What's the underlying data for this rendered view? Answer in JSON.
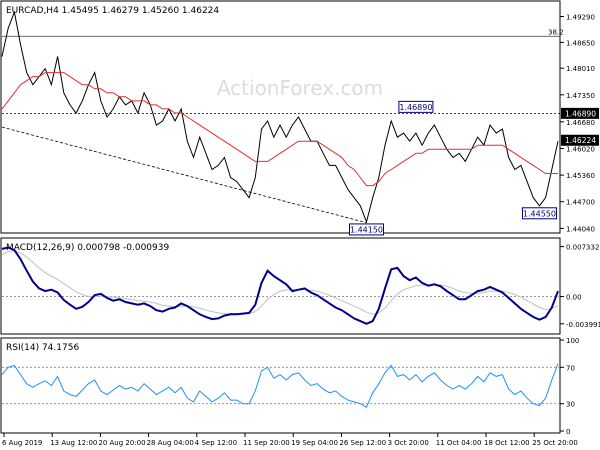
{
  "chart_data": [
    {
      "type": "candlestick",
      "header": "EURCAD,H4  1.45495 1.46279 1.45260 1.46224",
      "watermark": "ActionForex.com",
      "x_labels": [
        "6 Aug 2019",
        "13 Aug 12:00",
        "20 Aug 20:00",
        "28 Aug 04:00",
        "4 Sep 12:00",
        "11 Sep 20:00",
        "19 Sep 04:00",
        "26 Sep 12:00",
        "3 Oct 20:00",
        "11 Oct 04:00",
        "18 Oct 12:00",
        "25 Oct 20:00"
      ],
      "y_ticks": [
        1.4404,
        1.447,
        1.4536,
        1.4602,
        1.4668,
        1.4735,
        1.4801,
        1.4865,
        1.4929
      ],
      "y_tick_labels": [
        "1.44040",
        "1.44700",
        "1.45360",
        "1.46020",
        "1.46680",
        "1.47350",
        "1.48010",
        "1.48650",
        "1.49290"
      ],
      "ylim": [
        1.4395,
        1.4965
      ],
      "grid": false,
      "price_close": [
        1.483,
        1.49,
        1.494,
        1.486,
        1.479,
        1.476,
        1.478,
        1.48,
        1.476,
        1.483,
        1.474,
        1.471,
        1.469,
        1.472,
        1.476,
        1.479,
        1.472,
        1.468,
        1.47,
        1.473,
        1.471,
        1.472,
        1.469,
        1.474,
        1.471,
        1.466,
        1.467,
        1.47,
        1.467,
        1.47,
        1.462,
        1.458,
        1.463,
        1.459,
        1.455,
        1.456,
        1.458,
        1.453,
        1.452,
        1.45,
        1.448,
        1.453,
        1.465,
        1.467,
        1.463,
        1.466,
        1.463,
        1.466,
        1.468,
        1.465,
        1.462,
        1.462,
        1.459,
        1.456,
        1.456,
        1.453,
        1.45,
        1.448,
        1.446,
        1.442,
        1.448,
        1.453,
        1.461,
        1.467,
        1.463,
        1.464,
        1.462,
        1.464,
        1.461,
        1.464,
        1.466,
        1.463,
        1.46,
        1.458,
        1.459,
        1.457,
        1.46,
        1.463,
        1.461,
        1.466,
        1.464,
        1.465,
        1.458,
        1.455,
        1.456,
        1.452,
        1.448,
        1.446,
        1.448,
        1.455,
        1.462
      ],
      "moving_average_values": [
        1.47,
        1.472,
        1.474,
        1.476,
        1.477,
        1.478,
        1.478,
        1.479,
        1.479,
        1.479,
        1.479,
        1.478,
        1.477,
        1.476,
        1.476,
        1.475,
        1.475,
        1.474,
        1.474,
        1.473,
        1.473,
        1.472,
        1.472,
        1.472,
        1.471,
        1.471,
        1.47,
        1.47,
        1.469,
        1.469,
        1.468,
        1.467,
        1.466,
        1.465,
        1.464,
        1.463,
        1.462,
        1.461,
        1.46,
        1.459,
        1.458,
        1.457,
        1.457,
        1.457,
        1.458,
        1.459,
        1.46,
        1.461,
        1.462,
        1.462,
        1.462,
        1.462,
        1.461,
        1.46,
        1.459,
        1.458,
        1.456,
        1.455,
        1.453,
        1.451,
        1.451,
        1.452,
        1.454,
        1.455,
        1.456,
        1.457,
        1.458,
        1.459,
        1.459,
        1.46,
        1.46,
        1.46,
        1.46,
        1.46,
        1.46,
        1.46,
        1.46,
        1.461,
        1.461,
        1.461,
        1.461,
        1.461,
        1.46,
        1.459,
        1.458,
        1.457,
        1.456,
        1.455,
        1.454,
        1.454,
        1.454
      ],
      "trendline": {
        "start": 1.4655,
        "end": 1.4418
      },
      "resistance_level": 1.4689,
      "fib_level": 1.488,
      "fib_label": "38.2",
      "annotations": [
        {
          "label": "1.46890",
          "value": 1.4689,
          "index": 67
        },
        {
          "label": "1.44150",
          "value": 1.4415,
          "index": 59
        },
        {
          "label": "1.44550",
          "value": 1.4455,
          "index": 87
        }
      ],
      "last_price_label": "1.46224",
      "last_price": 1.46224
    },
    {
      "type": "line",
      "title": "MACD(12,26,9) 0.000798 -0.000939",
      "y_tick_labels": [
        "0.007332",
        "0.00",
        "-0.003991"
      ],
      "y_ticks": [
        0.007332,
        0.0,
        -0.003991
      ],
      "ylim": [
        -0.0052,
        0.0083
      ],
      "zero_line": 0.0,
      "series": [
        {
          "values": [
            0.007,
            0.0072,
            0.0068,
            0.0055,
            0.0038,
            0.0022,
            0.0012,
            0.0008,
            0.001,
            0.0006,
            -0.0005,
            -0.0012,
            -0.0018,
            -0.0015,
            -0.0008,
            0.0002,
            0.0004,
            -0.0002,
            -0.0006,
            -0.0004,
            -0.0008,
            -0.001,
            -0.0012,
            -0.001,
            -0.0014,
            -0.002,
            -0.0022,
            -0.0018,
            -0.0016,
            -0.001,
            -0.0014,
            -0.002,
            -0.0026,
            -0.003,
            -0.0033,
            -0.0032,
            -0.0028,
            -0.0026,
            -0.0026,
            -0.0025,
            -0.0024,
            -0.0012,
            0.002,
            0.0038,
            0.003,
            0.0024,
            0.0018,
            0.0008,
            0.001,
            0.0012,
            0.0006,
            0.0002,
            -0.0004,
            -0.001,
            -0.0016,
            -0.002,
            -0.0026,
            -0.0032,
            -0.0036,
            -0.004,
            -0.0036,
            -0.0018,
            0.0012,
            0.004,
            0.0042,
            0.003,
            0.0024,
            0.0028,
            0.002,
            0.0016,
            0.0018,
            0.0015,
            0.0008,
            0.0002,
            -0.0004,
            -0.0004,
            0.0002,
            0.0008,
            0.001,
            0.0014,
            0.001,
            0.0006,
            -0.0002,
            -0.001,
            -0.0018,
            -0.0024,
            -0.003,
            -0.0034,
            -0.003,
            -0.0016,
            0.0008
          ]
        },
        {
          "values": [
            0.0062,
            0.0066,
            0.0067,
            0.0064,
            0.0058,
            0.005,
            0.0042,
            0.0035,
            0.003,
            0.0025,
            0.0019,
            0.0013,
            0.0007,
            0.0003,
            0.0,
            0.0,
            0.0001,
            0.0,
            -0.0001,
            -0.0002,
            -0.0003,
            -0.0004,
            -0.0006,
            -0.0007,
            -0.0008,
            -0.001,
            -0.0013,
            -0.0014,
            -0.0015,
            -0.0014,
            -0.0014,
            -0.0015,
            -0.0017,
            -0.002,
            -0.0022,
            -0.0024,
            -0.0025,
            -0.0025,
            -0.0025,
            -0.0025,
            -0.0025,
            -0.0022,
            -0.0014,
            -0.0004,
            0.0003,
            0.0008,
            0.001,
            0.001,
            0.001,
            0.001,
            0.0009,
            0.0008,
            0.0005,
            0.0002,
            -0.0002,
            -0.0006,
            -0.001,
            -0.0014,
            -0.0018,
            -0.0023,
            -0.0026,
            -0.0024,
            -0.0017,
            -0.0006,
            0.0004,
            0.001,
            0.0013,
            0.0016,
            0.0017,
            0.0017,
            0.0017,
            0.0017,
            0.0015,
            0.0012,
            0.0008,
            0.0006,
            0.0005,
            0.0005,
            0.0006,
            0.0008,
            0.0008,
            0.0008,
            0.0006,
            0.0003,
            -0.0001,
            -0.0006,
            -0.0011,
            -0.0016,
            -0.0019,
            -0.0018,
            -0.0013
          ]
        }
      ]
    },
    {
      "type": "line",
      "title": "RSI(14) 74.1756",
      "y_ticks": [
        100,
        70,
        30,
        0
      ],
      "y_tick_labels": [
        "100",
        "70",
        "30",
        "0"
      ],
      "ylim": [
        0,
        100
      ],
      "levels": [
        70,
        30
      ],
      "series": [
        {
          "values": [
            62,
            70,
            72,
            62,
            52,
            48,
            52,
            55,
            50,
            60,
            44,
            40,
            38,
            45,
            52,
            56,
            44,
            40,
            45,
            50,
            46,
            48,
            44,
            52,
            46,
            40,
            44,
            48,
            42,
            48,
            36,
            32,
            44,
            38,
            32,
            36,
            42,
            34,
            34,
            30,
            30,
            44,
            66,
            70,
            58,
            62,
            56,
            62,
            64,
            56,
            50,
            52,
            46,
            42,
            44,
            38,
            34,
            32,
            30,
            26,
            42,
            52,
            64,
            72,
            60,
            62,
            56,
            62,
            54,
            60,
            64,
            56,
            50,
            46,
            50,
            46,
            52,
            60,
            54,
            64,
            60,
            62,
            46,
            40,
            44,
            36,
            30,
            28,
            36,
            56,
            74
          ]
        }
      ]
    }
  ]
}
